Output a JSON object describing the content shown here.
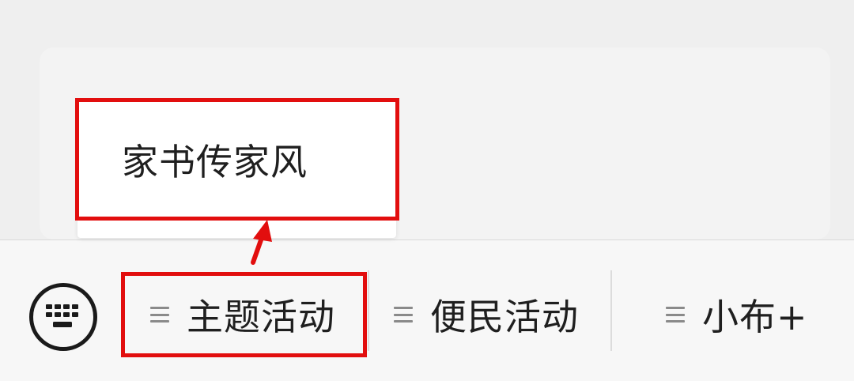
{
  "popup_menu": {
    "items": [
      {
        "label": "家书传家风"
      }
    ]
  },
  "menu_bar": {
    "tabs": [
      {
        "label": "主题活动"
      },
      {
        "label": "便民活动"
      },
      {
        "label": "小布+"
      }
    ]
  },
  "colors": {
    "highlight": "#e20e0e",
    "text": "#1f1f1f",
    "menu_icon": "#8a8a8a"
  },
  "icons": {
    "keyboard_toggle": "keyboard-icon",
    "submenu_indicator": "menu-lines-icon",
    "annotation": "arrow-up-icon"
  }
}
